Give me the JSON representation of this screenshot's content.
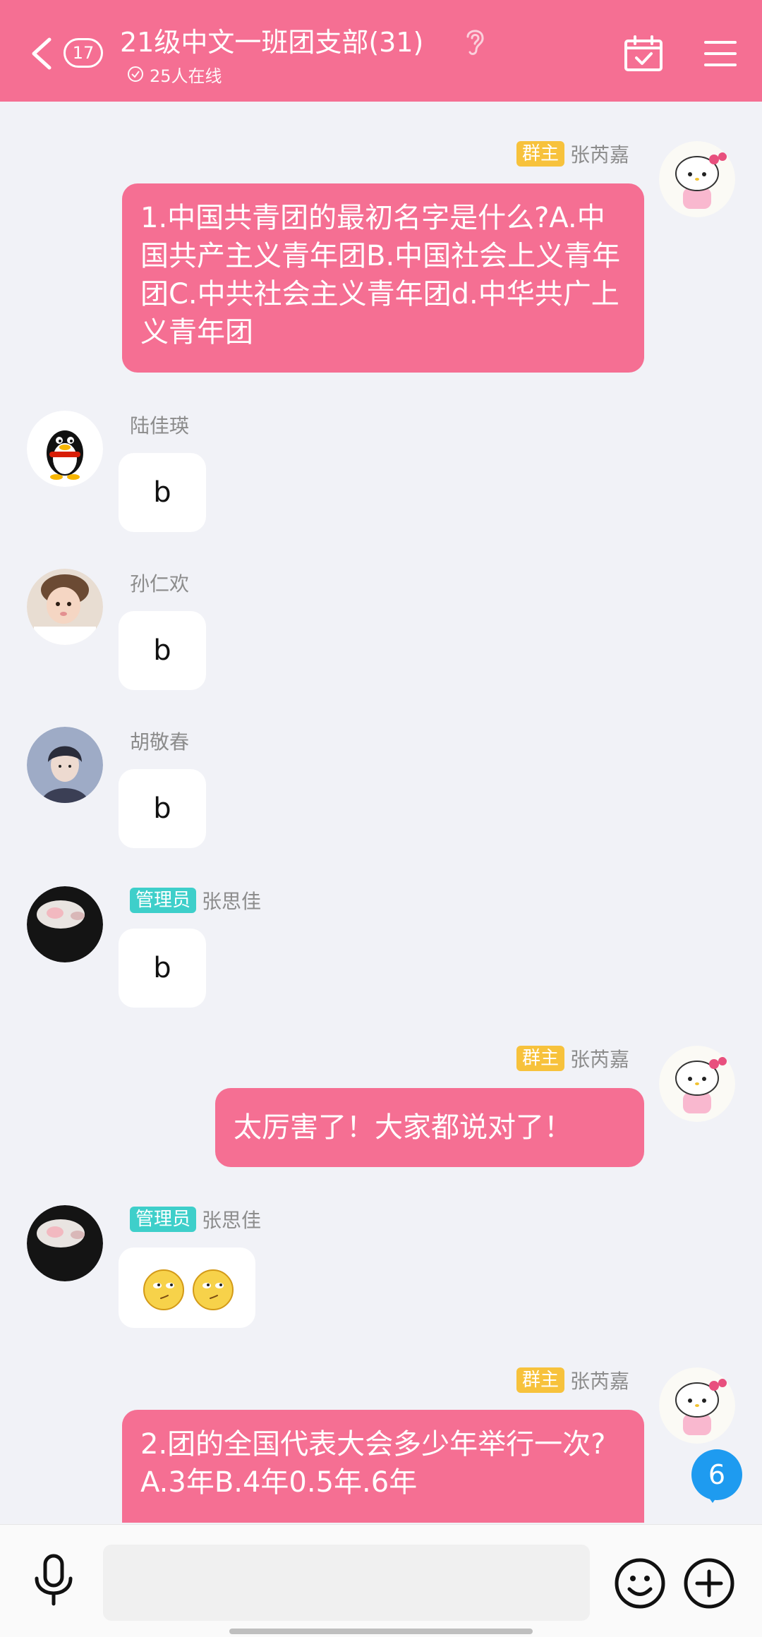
{
  "header": {
    "back_count": "17",
    "title": "21级中文一班团支部(31)",
    "online_text": "25人在线"
  },
  "messages": [
    {
      "sender": "张芮嘉",
      "badge": "群主",
      "text": "1.中国共青团的最初名字是什么?A.中国共产主义青年团B.中国社会上义青年团C.中共社会主义青年团d.中华共广上义青年团"
    },
    {
      "sender": "陆佳瑛",
      "text": "b"
    },
    {
      "sender": "孙仁欢",
      "text": "b"
    },
    {
      "sender": "胡敬春",
      "text": "b"
    },
    {
      "sender": "张思佳",
      "badge": "管理员",
      "text": "b"
    },
    {
      "sender": "张芮嘉",
      "badge": "群主",
      "text": "太厉害了！大家都说对了！"
    },
    {
      "sender": "张思佳",
      "badge": "管理员",
      "emoji": [
        "smug-face-emoji",
        "smug-face-emoji"
      ]
    },
    {
      "sender": "张芮嘉",
      "badge": "群主",
      "text": "2.团的全国代表大会多少年举行一次?A.3年B.4年0.5年.6年"
    }
  ],
  "unread_count": "6",
  "input": {
    "placeholder": ""
  },
  "icons": {
    "back": "chevron-left-icon",
    "ear": "ear-icon",
    "calendar": "calendar-check-icon",
    "menu": "menu-icon",
    "mic": "microphone-icon",
    "emoji": "smiley-icon",
    "plus": "plus-circle-icon"
  },
  "colors": {
    "header": "#f56f93",
    "my_bubble": "#f56f93",
    "background": "#f1f2f7",
    "owner_badge": "#f7c23c",
    "admin_badge": "#3ecfca",
    "unread": "#1e9bf0"
  }
}
